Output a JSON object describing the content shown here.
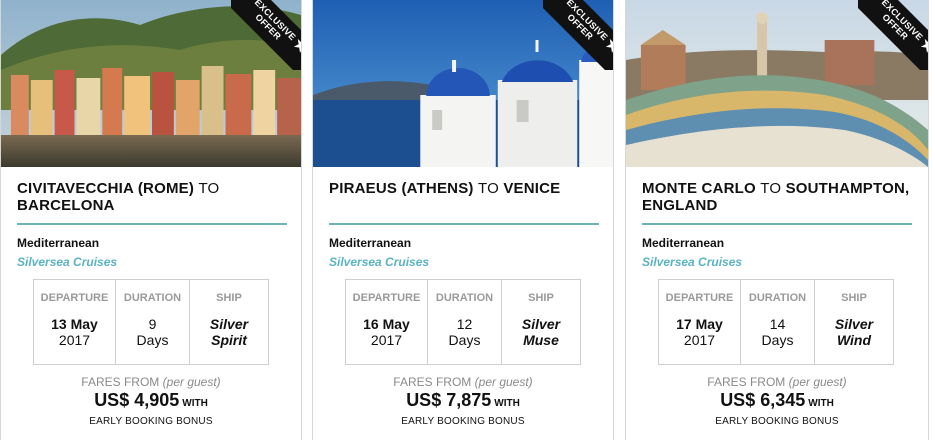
{
  "cards": [
    {
      "ribbon": "EXCLUSIVE OFFER",
      "origin": "CIVITAVECCHIA (ROME)",
      "to": "TO",
      "destination": "BARCELONA",
      "region": "Mediterranean",
      "cruise_line": "Silversea Cruises",
      "headers": {
        "departure": "DEPARTURE",
        "duration": "DURATION",
        "ship": "SHIP"
      },
      "departure": {
        "day": "13 May",
        "year": "2017"
      },
      "duration": {
        "num": "9",
        "unit": "Days"
      },
      "ship": {
        "line1": "Silver",
        "line2": "Spirit"
      },
      "fares_label": "FARES FROM",
      "per_guest": "(per guest)",
      "price": "US$ 4,905",
      "with": "WITH",
      "bonus": "EARLY BOOKING BONUS",
      "image": "portofino-harbor-photo"
    },
    {
      "ribbon": "EXCLUSIVE OFFER",
      "origin": "PIRAEUS (ATHENS)",
      "to": "TO",
      "destination": "VENICE",
      "region": "Mediterranean",
      "cruise_line": "Silversea Cruises",
      "headers": {
        "departure": "DEPARTURE",
        "duration": "DURATION",
        "ship": "SHIP"
      },
      "departure": {
        "day": "16 May",
        "year": "2017"
      },
      "duration": {
        "num": "12",
        "unit": "Days"
      },
      "ship": {
        "line1": "Silver",
        "line2": "Muse"
      },
      "fares_label": "FARES FROM",
      "per_guest": "(per guest)",
      "price": "US$ 7,875",
      "with": "WITH",
      "bonus": "EARLY BOOKING BONUS",
      "image": "santorini-domes-photo"
    },
    {
      "ribbon": "EXCLUSIVE OFFER",
      "origin": "MONTE CARLO",
      "to": "TO",
      "destination": "SOUTHAMPTON, ENGLAND",
      "region": "Mediterranean",
      "cruise_line": "Silversea Cruises",
      "headers": {
        "departure": "DEPARTURE",
        "duration": "DURATION",
        "ship": "SHIP"
      },
      "departure": {
        "day": "17 May",
        "year": "2017"
      },
      "duration": {
        "num": "14",
        "unit": "Days"
      },
      "ship": {
        "line1": "Silver",
        "line2": "Wind"
      },
      "fares_label": "FARES FROM",
      "per_guest": "(per guest)",
      "price": "US$ 6,345",
      "with": "WITH",
      "bonus": "EARLY BOOKING BONUS",
      "image": "park-guell-photo"
    }
  ],
  "colors": {
    "accent": "#6cb3bd",
    "cruise_line": "#5ab3c2",
    "ribbon": "#111111",
    "muted": "#9a9a9a"
  },
  "icons": {
    "ribbon_star": "star-icon"
  }
}
